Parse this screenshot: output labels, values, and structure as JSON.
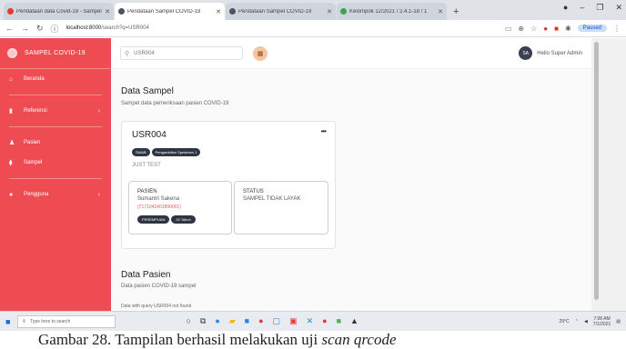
{
  "browser": {
    "tabs": [
      {
        "title": "Pendataan data Covid-19 - Sampel",
        "active": false
      },
      {
        "title": "Pendataan Sampel COVID-19",
        "active": true
      },
      {
        "title": "Pendataan Sampel COVID-19",
        "active": false
      },
      {
        "title": "Kelompok 12/2021 / 2.4.1-18 / 1",
        "active": false
      }
    ],
    "new_tab": "+",
    "url_host": "localhost:8000",
    "url_path": "/search?q=USR004",
    "profile_label": "Paused"
  },
  "sidebar": {
    "brand": "SAMPEL COVID-19",
    "items": [
      {
        "label": "Beranda",
        "icon": "home-icon",
        "chevron": false
      },
      {
        "label": "Referensi",
        "icon": "book-icon",
        "chevron": true
      },
      {
        "label": "Pasien",
        "icon": "person-icon",
        "chevron": false
      },
      {
        "label": "Sampel",
        "icon": "vial-icon",
        "chevron": false
      },
      {
        "label": "Pengguna",
        "icon": "users-icon",
        "chevron": true
      }
    ]
  },
  "topbar": {
    "search_value": "USR004",
    "user_initials": "SA",
    "user_greeting": "Hello Super Admin"
  },
  "main": {
    "title": "Data Sampel",
    "subtitle": "Sampel data pemeriksaan pasien COVID-19",
    "card": {
      "code": "USR004",
      "badges": [
        "SWAB",
        "Pengambilan Spesimen 1"
      ],
      "test": "JUST TEST",
      "patient_label": "PASIEN",
      "patient_name": "Sumantri Sakena",
      "patient_nik": "(7171042401890001)",
      "patient_chips": [
        "PEREMPUAN",
        "32 Tahun"
      ],
      "status_label": "STATUS",
      "status_value": "SAMPEL TIDAK LAYAK"
    },
    "patients_title": "Data Pasien",
    "patients_subtitle": "Data pasien COVID-19 sampel",
    "not_found": "Data with query USR004 not found"
  },
  "taskbar": {
    "search_placeholder": "Type here to search",
    "temp": "29°C",
    "time": "7:08 AM",
    "date": "7/1/2021"
  },
  "caption": {
    "text": "Gambar 28. Tampilan berhasil melakukan uji ",
    "italic": "scan qrcode"
  }
}
